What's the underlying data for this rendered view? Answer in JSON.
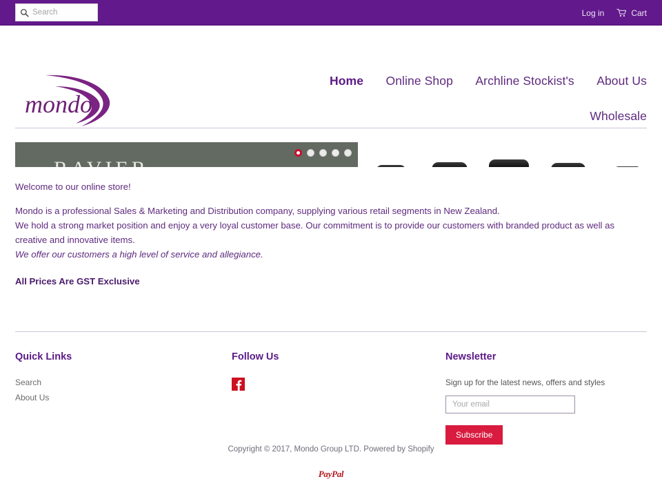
{
  "colors": {
    "header_purple": "#62198c",
    "nav_purple": "#5e2a7e",
    "body_purple": "#5e2a7e",
    "accent_red": "#d81b3f",
    "paypal_red": "#b01920",
    "slide_bg": "#626a62",
    "facebook_red": "#cc1122"
  },
  "topbar": {
    "search": {
      "placeholder": "Search",
      "value": "",
      "icon": "search-icon"
    },
    "login_label": "Log in",
    "cart_label": "Cart",
    "cart_icon": "cart-icon"
  },
  "header": {
    "logo_text": "mondo",
    "nav": {
      "row1": [
        {
          "label": "Home",
          "active": true
        },
        {
          "label": "Online Shop",
          "active": false
        },
        {
          "label": "Archline Stockist's",
          "active": false
        },
        {
          "label": "About Us",
          "active": false
        }
      ],
      "row2": [
        {
          "label": "Wholesale",
          "active": false
        }
      ]
    }
  },
  "hero": {
    "slide_title": "RAVIER",
    "dots": [
      {
        "active": true
      },
      {
        "active": false
      },
      {
        "active": false
      },
      {
        "active": false
      },
      {
        "active": false
      }
    ],
    "thumbnails": [
      {
        "name": "product-thumbnail-1"
      },
      {
        "name": "product-thumbnail-2"
      },
      {
        "name": "product-thumbnail-3"
      },
      {
        "name": "product-thumbnail-4"
      },
      {
        "name": "product-thumbnail-5"
      }
    ]
  },
  "main": {
    "welcome": "Welcome to our online store!",
    "para1": "Mondo is a professional Sales & Marketing and Distribution company, supplying various retail segments in New Zealand.",
    "para2": "We hold a strong market position and enjoy a very loyal customer base. Our commitment is to provide our customers with branded product as well as creative and innovative items.",
    "para3_italic": "We offer our customers a high level of service and allegiance.",
    "gst_notice": "All Prices Are GST Exclusive"
  },
  "footer": {
    "quick_links": {
      "heading": "Quick Links",
      "items": [
        {
          "label": "Search"
        },
        {
          "label": "About Us"
        }
      ]
    },
    "follow_us": {
      "heading": "Follow Us",
      "icon": "facebook-icon"
    },
    "newsletter": {
      "heading": "Newsletter",
      "description": "Sign up for the latest news, offers and styles",
      "email_placeholder": "Your email",
      "email_value": "",
      "subscribe_label": "Subscribe"
    },
    "copyright": "Copyright © 2017, Mondo Group LTD. Powered by Shopify",
    "payment_logo": "PayPal"
  }
}
